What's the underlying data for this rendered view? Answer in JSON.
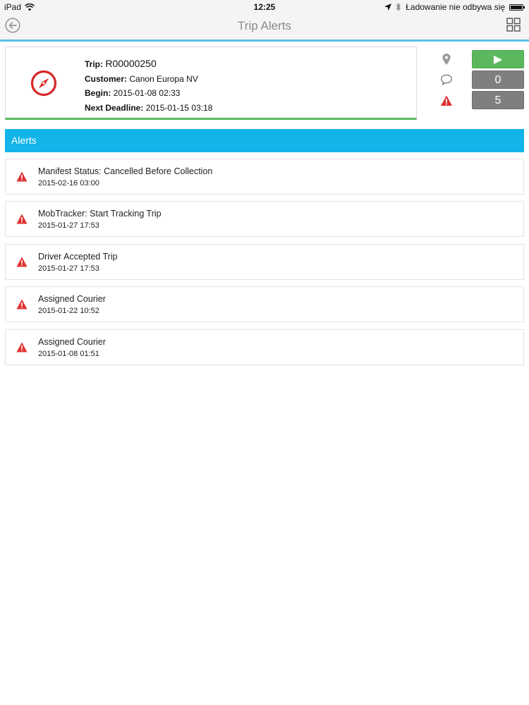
{
  "status_bar": {
    "device": "iPad",
    "time": "12:25",
    "charging_text": "Ładowanie nie odbywa się"
  },
  "nav": {
    "title": "Trip Alerts",
    "back_icon": "back-arrow-circle-icon",
    "menu_icon": "grid-icon"
  },
  "trip": {
    "trip_label": "Trip:",
    "trip_id": "R00000250",
    "customer_label": "Customer:",
    "customer": "Canon Europa NV",
    "begin_label": "Begin:",
    "begin": "2015-01-08 02:33",
    "deadline_label": "Next Deadline:",
    "deadline": "2015-01-15 03:18",
    "status_icon": "compass-icon"
  },
  "side": {
    "play_symbol": "▶",
    "messages_count": "0",
    "alerts_count": "5"
  },
  "alerts_header": "Alerts",
  "alerts": [
    {
      "title": "Manifest Status: Cancelled Before Collection",
      "date": "2015-02-16 03:00"
    },
    {
      "title": "MobTracker: Start Tracking Trip",
      "date": "2015-01-27 17:53"
    },
    {
      "title": "Driver Accepted Trip",
      "date": "2015-01-27 17:53"
    },
    {
      "title": "Assigned Courier",
      "date": "2015-01-22 10:52"
    },
    {
      "title": "Assigned Courier",
      "date": "2015-01-08 01:51"
    }
  ],
  "colors": {
    "accent_blue": "#12b4ea",
    "success_green": "#5cb85c",
    "counter_grey": "#7f7f7f",
    "alert_red": "#e03131",
    "compass_red": "#d62828"
  }
}
